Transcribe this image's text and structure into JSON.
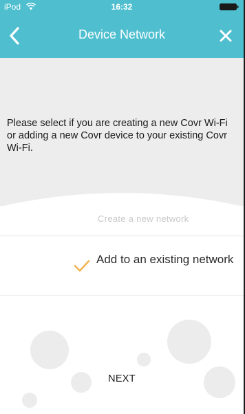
{
  "status_bar": {
    "carrier": "iPod",
    "time": "16:32",
    "wifi_icon": "wifi-icon",
    "battery_icon": "battery-icon"
  },
  "nav": {
    "title": "Device Network",
    "back_icon": "chevron-left-icon",
    "close_icon": "close-icon"
  },
  "info": {
    "text": "Please select if you are creating a new Covr Wi-Fi or adding a new Covr device to your existing Covr Wi-Fi."
  },
  "options": {
    "create_label": "Create a new network",
    "existing_label": "Add to an existing network",
    "selected": "existing"
  },
  "footer": {
    "next_label": "NEXT"
  },
  "colors": {
    "header": "#4fbfcf",
    "panel": "#ededed",
    "check": "#f2b451",
    "bubbles": "#ececec",
    "muted_text": "#c8c8c8"
  }
}
